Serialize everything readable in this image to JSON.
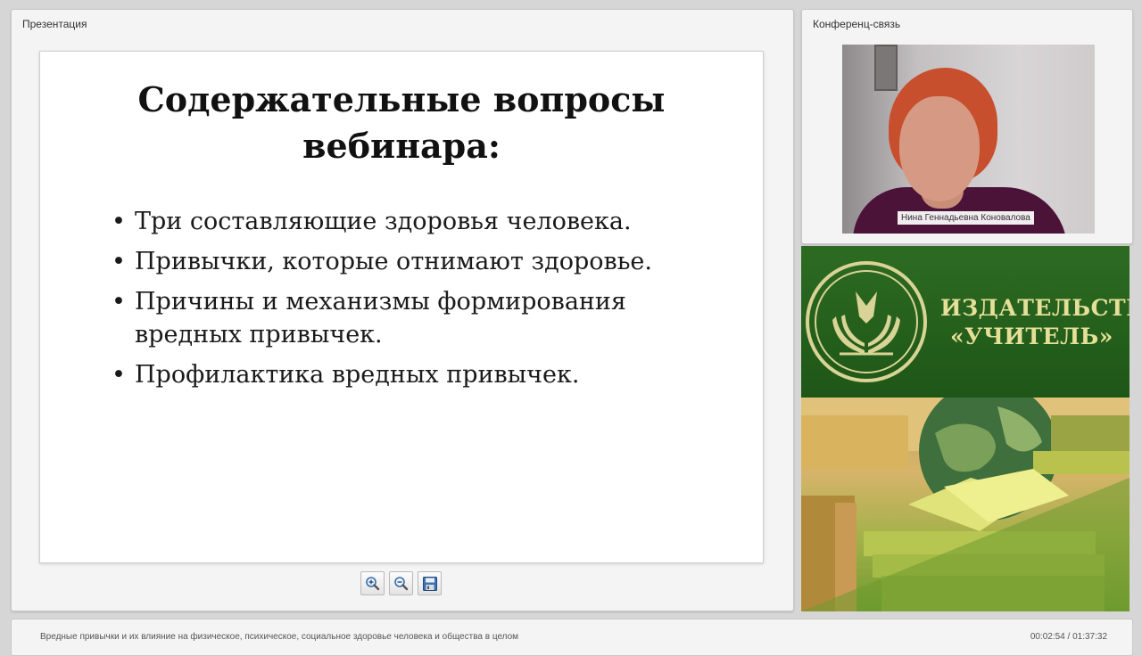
{
  "presentation": {
    "panel_title": "Презентация",
    "slide": {
      "title_lines": [
        "Содержательные вопросы",
        "вебинара:"
      ],
      "bullet_char": "•",
      "bullets": [
        "Три составляющие здоровья человека.",
        "Привычки, которые отнимают здоровье.",
        "Причины и механизмы формирования вредных привычек.",
        "Профилактика вредных привычек."
      ]
    },
    "toolbar": [
      {
        "name": "zoom-in-icon"
      },
      {
        "name": "zoom-out-icon"
      },
      {
        "name": "save-icon"
      }
    ]
  },
  "conference": {
    "panel_title": "Конференц-связь",
    "speaker_name": "Нина Геннадьевна Коновалова"
  },
  "banner": {
    "publisher_lines": [
      "ИЗДАТЕЛЬСТВО",
      "«УЧИТЕЛЬ»"
    ],
    "accent_color": "#e5df98",
    "background_color": "#1f5b1a"
  },
  "footer": {
    "webinar_title": "Вредные привычки и их влияние на физическое, психическое, социальное здоровье человека и общества в целом",
    "time": "00:02:54 / 01:37:32"
  }
}
